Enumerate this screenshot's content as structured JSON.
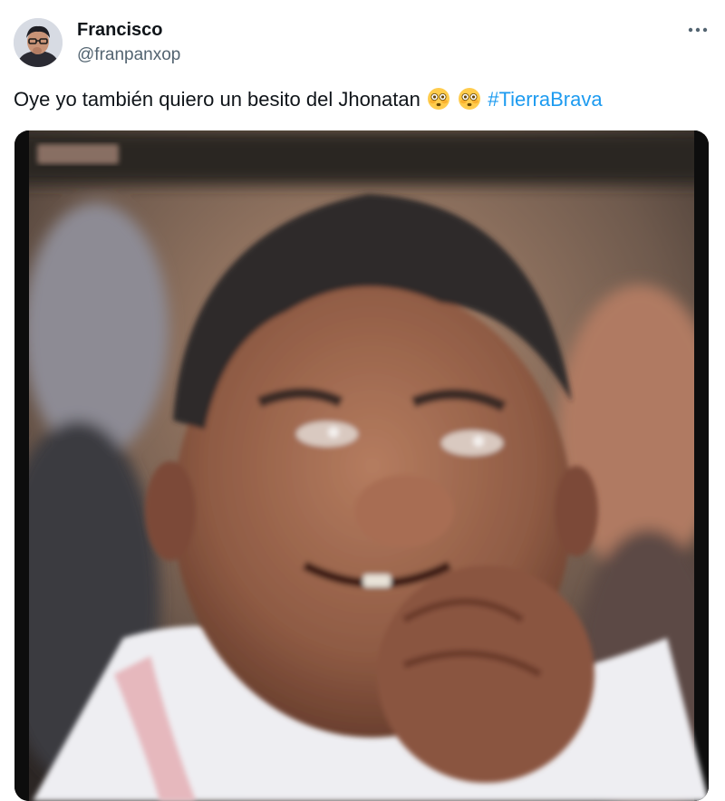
{
  "author": {
    "display_name": "Francisco",
    "handle": "@franpanxop",
    "avatar_icon": "profile-avatar"
  },
  "menu": {
    "icon": "more-options-icon"
  },
  "tweet": {
    "text": "Oye yo también quiero un besito del Jhonatan",
    "emojis": [
      "😳",
      "😳"
    ],
    "hashtag": "#TierraBrava"
  },
  "media": {
    "type": "gif",
    "description_icon": "meme-image"
  },
  "colors": {
    "text": "#0f1419",
    "secondary": "#536471",
    "link": "#1d9bf0"
  }
}
